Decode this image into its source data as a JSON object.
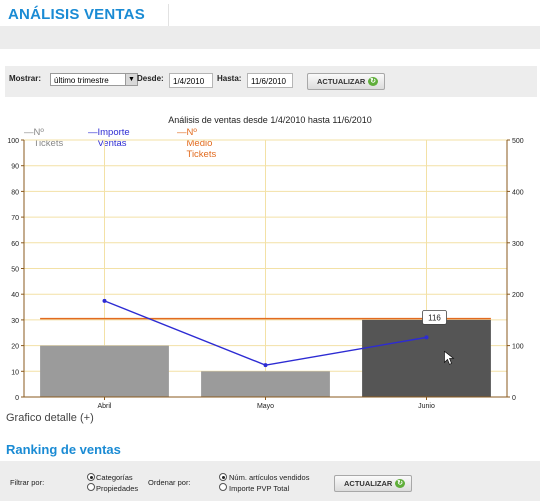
{
  "header": {
    "title": "ANÁLISIS VENTAS"
  },
  "filters": {
    "mostrar_label": "Mostrar:",
    "mostrar_value": "último trimestre",
    "desde_label": "Desde:",
    "desde_value": "1/4/2010",
    "hasta_label": "Hasta:",
    "hasta_value": "11/6/2010",
    "button_label": "ACTUALIZAR"
  },
  "chart_data": {
    "type": "bar",
    "title": "Análisis de ventas desde 1/4/2010 hasta 11/6/2010",
    "categories": [
      "Abril",
      "Mayo",
      "Junio"
    ],
    "series": [
      {
        "name": "Nº Tickets",
        "type": "bar",
        "axis": "left",
        "values": [
          20,
          10,
          30
        ],
        "colors": [
          "#9b9b9b",
          "#9b9b9b",
          "#555555"
        ]
      },
      {
        "name": "Importe Ventas",
        "type": "line",
        "axis": "right",
        "values": [
          187,
          62,
          116
        ],
        "color": "#2d2bd3"
      },
      {
        "name": "Nº Medio Tickets",
        "type": "line",
        "axis": "left",
        "values": [
          30.5,
          30.5,
          30.5
        ],
        "color": "#e26b1f"
      }
    ],
    "ylim_left": [
      0,
      100
    ],
    "yticks_left": [
      "0",
      "10",
      "20",
      "30",
      "40",
      "50",
      "60",
      "70",
      "80",
      "90",
      "100"
    ],
    "ylim_right": [
      0,
      500
    ],
    "yticks_right": [
      "0",
      "100",
      "200",
      "300",
      "400",
      "500"
    ],
    "tooltip": "116",
    "grid": true,
    "legend_position": "top"
  },
  "detalle": {
    "label": "Grafico detalle (+)"
  },
  "ranking": {
    "title": "Ranking de ventas",
    "filtrar_label": "Filtrar por:",
    "opt_categorias": "Categorías",
    "opt_propiedades": "Propiedades",
    "ordenar_label": "Ordenar por:",
    "opt_articulos": "Núm. artículos vendidos",
    "opt_importe": "Importe PVP Total",
    "button_label": "ACTUALIZAR"
  },
  "colors": {
    "accent": "#1a8bd4",
    "bar": "#9b9b9b",
    "bar_selected": "#555555",
    "sales_line": "#2d2bd3",
    "avg_line": "#e26b1f",
    "grid": "#f3e1a6"
  }
}
